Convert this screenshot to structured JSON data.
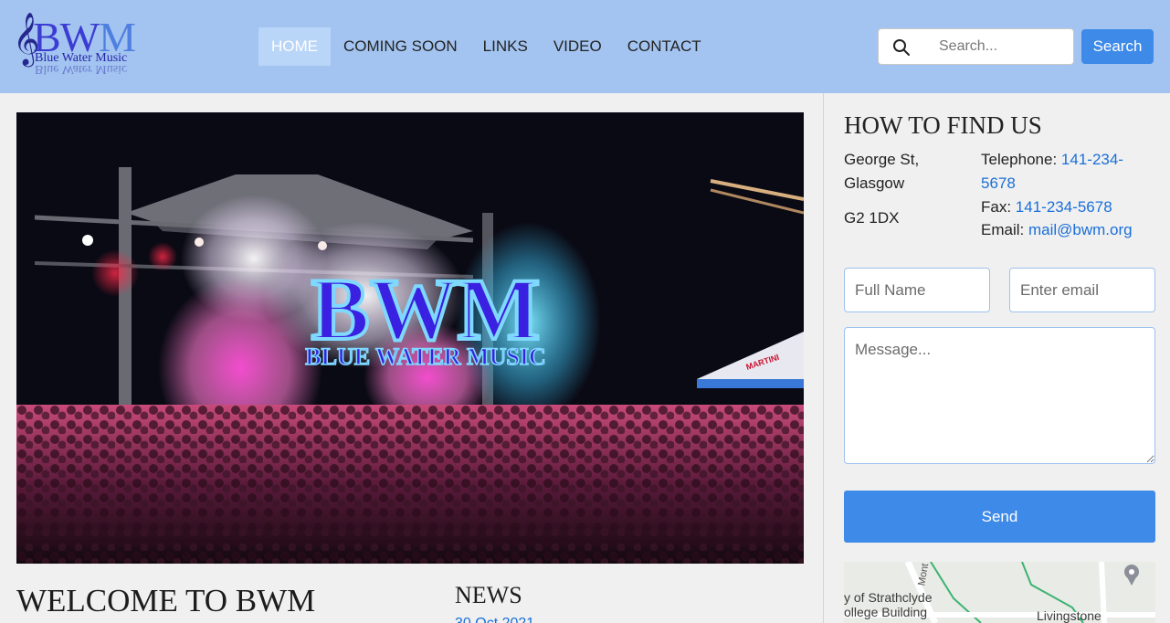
{
  "logo": {
    "text_b": "BW",
    "text_m": "M",
    "clef": "𝄞",
    "subtitle": "Blue Water Music"
  },
  "nav": {
    "items": [
      "HOME",
      "COMING SOON",
      "LINKS",
      "VIDEO",
      "CONTACT"
    ],
    "active": "HOME"
  },
  "search": {
    "placeholder": "Search...",
    "button_label": "Search",
    "icon": "search-icon"
  },
  "hero": {
    "banner_title": "BWM",
    "banner_subtitle": "BLUE WATER MUSIC",
    "tent_sign": "MARTINI"
  },
  "main": {
    "welcome_title": "WELCOME TO BWM",
    "news_title": "NEWS",
    "news_date": "30 Oct 2021"
  },
  "find_us": {
    "title": "HOW TO FIND US",
    "address_line1": "George St,",
    "address_line2": "Glasgow",
    "postcode": "G2 1DX",
    "telephone_label": "Telephone:",
    "telephone_value": "141-234-5678",
    "fax_label": "Fax:",
    "fax_value": "141-234-5678",
    "email_label": "Email:",
    "email_value": "mail@bwm.org"
  },
  "form": {
    "full_name_placeholder": "Full Name",
    "email_placeholder": "Enter email",
    "message_placeholder": "Message...",
    "send_label": "Send"
  },
  "map": {
    "label_line1": "y of Strathclyde",
    "label_line2": "ollege Building",
    "label_right": "Livingstone",
    "label_street": "Mont"
  },
  "colors": {
    "header_bg": "#a3c4f0",
    "accent": "#3e8ae8",
    "link": "#1a6fd8"
  }
}
